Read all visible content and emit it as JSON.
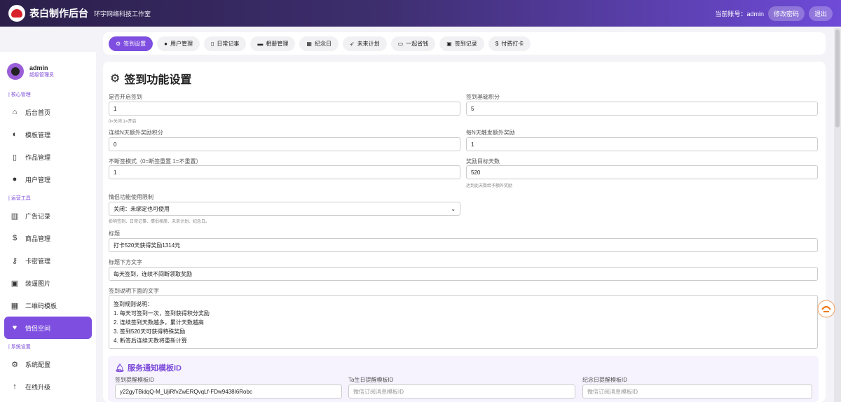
{
  "header": {
    "brand": "表白制作后台",
    "subtitle": "环宇网络科技工作室",
    "account_label": "当前账号：admin",
    "change_pwd": "修改密码",
    "logout": "退出"
  },
  "user": {
    "name": "admin",
    "role": "超级管理员"
  },
  "sidebar": {
    "sections": [
      {
        "title": "核心管理",
        "items": [
          "后台首页",
          "模板管理",
          "作品管理",
          "用户管理"
        ]
      },
      {
        "title": "运营工具",
        "items": [
          "广告记录",
          "商品管理",
          "卡密管理",
          "装逼图片",
          "二维码模板",
          "情侣空间"
        ]
      },
      {
        "title": "系统设置",
        "items": [
          "系统配置",
          "在线升级"
        ]
      }
    ]
  },
  "tabs": [
    "签到设置",
    "用户管理",
    "日常记事",
    "相册管理",
    "纪念日",
    "未来计划",
    "一起省钱",
    "签到记录",
    "付费打卡"
  ],
  "page": {
    "title": "签到功能设置",
    "fields": {
      "enable": {
        "label": "是否开启签到",
        "value": "1",
        "hint": "0=关闭 1=开启"
      },
      "base_points": {
        "label": "签到基础积分",
        "value": "5"
      },
      "streak_points": {
        "label": "连续N天额外奖励积分",
        "value": "0"
      },
      "every_n": {
        "label": "每N天触发额外奖励",
        "value": "1"
      },
      "mode": {
        "label": "不断签模式（0=断签重置 1=不重置）",
        "value": "1"
      },
      "target_days": {
        "label": "奖励目标天数",
        "value": "520",
        "hint": "达到此天数给予额外奖励"
      },
      "couple_limit": {
        "label": "情侣功能使用限制",
        "value": "关闭：未绑定也可使用",
        "hint": "影响签到、日常记事、情侣相册、未来计划、纪念日。"
      },
      "headline": {
        "label": "标题",
        "value": "打卡520天获得奖励1314元"
      },
      "sub_text": {
        "label": "标题下方文字",
        "value": "每天签到，连续不间断领取奖励"
      },
      "desc": {
        "label": "签到说明下面的文字",
        "lines": [
          "签到规则说明：",
          "1. 每天可签到一次，签到获得积分奖励",
          "2. 连续签到天数越多，累计天数越高",
          "3. 签到520天可获得特殊奖励",
          "4. 断签后连续天数将重新计算"
        ]
      }
    },
    "notice": {
      "title": "服务通知模板ID",
      "fields": [
        {
          "label": "签到提醒模板ID",
          "value": "y22gyTBidqQ-M_UjiRfvZwERQvqLf-FDw9438I6Robc",
          "placeholder": ""
        },
        {
          "label": "Ta生日提醒模板ID",
          "value": "",
          "placeholder": "微信订阅消息模板ID"
        },
        {
          "label": "纪念日提醒模板ID",
          "value": "",
          "placeholder": "微信订阅消息模板ID"
        }
      ]
    }
  },
  "colors": {
    "accent": "#7e4ee0",
    "header_start": "#2b1f4a",
    "header_end": "#6f4bd8"
  }
}
